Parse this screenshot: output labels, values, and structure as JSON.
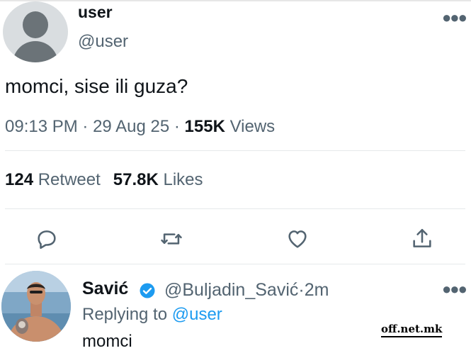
{
  "tweet": {
    "username": "user",
    "handle": "@user",
    "more_icon": "more-horizontal-icon",
    "text": "momci, sise ili guza?",
    "time": "09:13 PM",
    "date": "29 Aug 25",
    "views_count": "155K",
    "views_label": "Views",
    "separator": "·",
    "retweets_count": "124",
    "retweets_label": "Retweet",
    "likes_count": "57.8K",
    "likes_label": "Likes",
    "actions": [
      "reply-icon",
      "retweet-icon",
      "like-icon",
      "share-icon"
    ]
  },
  "reply": {
    "name": "Savić",
    "verified_icon": "verified-badge-icon",
    "handle": "@Buljadin_Savić",
    "separator": "·",
    "age": "2m",
    "replying_prefix": "Replying to",
    "replying_mention": "@user",
    "text": "momci"
  },
  "watermark": "off.net.mk",
  "colors": {
    "text": "#0f1419",
    "secondary": "#536471",
    "link": "#1d9bf0",
    "divider": "#e6e9eb"
  }
}
